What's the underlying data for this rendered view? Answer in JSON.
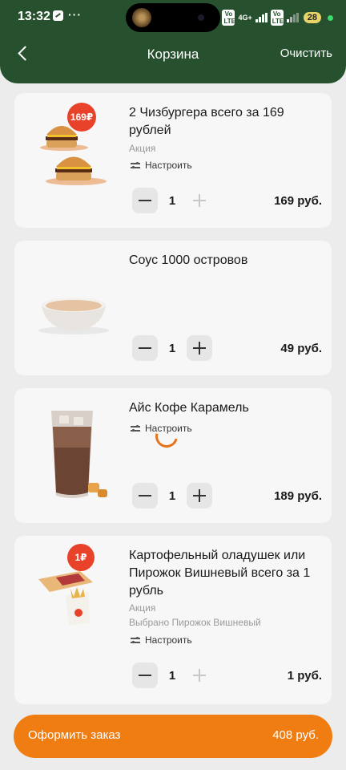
{
  "status_bar": {
    "time": "13:32",
    "network": "4G+",
    "volte": "Vo LTE",
    "battery": "28"
  },
  "header": {
    "title": "Корзина",
    "clear_label": "Очистить"
  },
  "items": [
    {
      "name": "2 Чизбургера всего за 169 рублей",
      "tag": "Акция",
      "customize": "Настроить",
      "qty": "1",
      "price": "169 руб.",
      "badge": "169₽"
    },
    {
      "name": "Соус 1000 островов",
      "qty": "1",
      "price": "49 руб."
    },
    {
      "name": "Айс Кофе Карамель",
      "customize": "Настроить",
      "qty": "1",
      "price": "189 руб."
    },
    {
      "name": "Картофельный оладушек или Пирожок Вишневый всего за 1 рубль",
      "tag": "Акция",
      "selection": "Выбрано Пирожок Вишневый",
      "customize": "Настроить",
      "qty": "1",
      "price": "1 руб.",
      "badge": "1₽"
    }
  ],
  "checkout": {
    "label": "Оформить заказ",
    "total": "408 руб."
  },
  "colors": {
    "header_bg": "#27502f",
    "accent": "#f07d12",
    "badge": "#e8432a"
  }
}
